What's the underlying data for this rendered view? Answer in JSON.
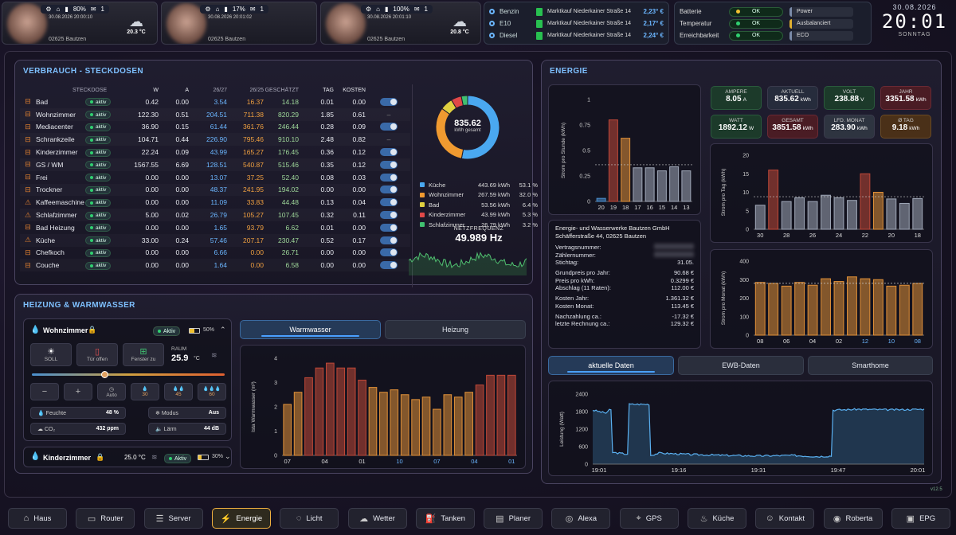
{
  "cams": [
    {
      "status": {
        "pct": "80%",
        "mail": "1"
      },
      "date": "30.08.2026 20:00:10",
      "zip": "02625 Bautzen",
      "temp": "20.3 °C"
    },
    {
      "status": {
        "pct": "17%",
        "mail": "1"
      },
      "date": "30.08.2026 20:01:02",
      "zip": "02625 Bautzen",
      "temp": ""
    },
    {
      "status": {
        "pct": "100%",
        "mail": "1"
      },
      "date": "30.08.2026 20:01:10",
      "zip": "02625 Bautzen",
      "temp": "20.8 °C"
    }
  ],
  "fuel": [
    {
      "name": "Benzin",
      "station": "Marktkauf Niederkainer Straße 14",
      "price": "2,23° €"
    },
    {
      "name": "E10",
      "station": "Marktkauf Niederkainer Straße 14",
      "price": "2,17° €"
    },
    {
      "name": "Diesel",
      "station": "Marktkauf Niederkainer Straße 14",
      "price": "2,24° €"
    }
  ],
  "system": [
    {
      "label": "Batterie",
      "status": "OK",
      "tag": "Power",
      "status_color": "#f0c030"
    },
    {
      "label": "Temperatur",
      "status": "OK",
      "tag": "Ausbalanciert",
      "status_color": "#30d070"
    },
    {
      "label": "Erreichbarkeit",
      "status": "OK",
      "tag": "ECO",
      "status_color": "#30d070"
    }
  ],
  "clock": {
    "date": "30.08.2026",
    "time": "20:01",
    "weekday": "SONNTAG"
  },
  "verbrauch": {
    "title": "VERBRAUCH - STECKDOSEN",
    "headers": [
      "STECKDOSE",
      "W",
      "A",
      "26/27",
      "26/25",
      "GESCHÄTZT",
      "TAG",
      "KOSTEN"
    ],
    "badge": "aktiv",
    "rows": [
      {
        "name": "Bad",
        "w": "0.42",
        "a": "0.00",
        "v1": "3.54",
        "v2": "16.37",
        "g": "14.18",
        "tag": "0.01",
        "k": "0.00",
        "sw": true,
        "icon": "plug"
      },
      {
        "name": "Wohnzimmer",
        "w": "122.30",
        "a": "0.51",
        "v1": "204.51",
        "v2": "711.38",
        "g": "820.29",
        "tag": "1.85",
        "k": "0.61",
        "sw": false,
        "icon": "plug"
      },
      {
        "name": "Mediacenter",
        "w": "36.90",
        "a": "0.15",
        "v1": "61.44",
        "v2": "361.76",
        "g": "246.44",
        "tag": "0.28",
        "k": "0.09",
        "sw": true,
        "icon": "plug"
      },
      {
        "name": "Schrankzeile",
        "w": "104.71",
        "a": "0.44",
        "v1": "226.90",
        "v2": "795.46",
        "g": "910.10",
        "tag": "2.48",
        "k": "0.82",
        "sw": false,
        "icon": "plug"
      },
      {
        "name": "Kinderzimmer",
        "w": "22.24",
        "a": "0.09",
        "v1": "43.99",
        "v2": "165.27",
        "g": "176.45",
        "tag": "0.36",
        "k": "0.12",
        "sw": true,
        "icon": "plug"
      },
      {
        "name": "GS / WM",
        "w": "1567.55",
        "a": "6.69",
        "v1": "128.51",
        "v2": "540.87",
        "g": "515.46",
        "tag": "0.35",
        "k": "0.12",
        "sw": true,
        "icon": "plug"
      },
      {
        "name": "Frei",
        "w": "0.00",
        "a": "0.00",
        "v1": "13.07",
        "v2": "37.25",
        "g": "52.40",
        "tag": "0.08",
        "k": "0.03",
        "sw": true,
        "icon": "plug"
      },
      {
        "name": "Trockner",
        "w": "0.00",
        "a": "0.00",
        "v1": "48.37",
        "v2": "241.95",
        "g": "194.02",
        "tag": "0.00",
        "k": "0.00",
        "sw": true,
        "icon": "plug"
      },
      {
        "name": "Kaffeemaschine",
        "w": "0.00",
        "a": "0.00",
        "v1": "11.09",
        "v2": "33.83",
        "g": "44.48",
        "tag": "0.13",
        "k": "0.04",
        "sw": true,
        "icon": "warn"
      },
      {
        "name": "Schlafzimmer",
        "w": "5.00",
        "a": "0.02",
        "v1": "26.79",
        "v2": "105.27",
        "g": "107.45",
        "tag": "0.32",
        "k": "0.11",
        "sw": true,
        "icon": "warn"
      },
      {
        "name": "Bad Heizung",
        "w": "0.00",
        "a": "0.00",
        "v1": "1.65",
        "v2": "93.79",
        "g": "6.62",
        "tag": "0.01",
        "k": "0.00",
        "sw": true,
        "icon": "plug"
      },
      {
        "name": "Küche",
        "w": "33.00",
        "a": "0.24",
        "v1": "57.46",
        "v2": "207.17",
        "g": "230.47",
        "tag": "0.52",
        "k": "0.17",
        "sw": true,
        "icon": "warn"
      },
      {
        "name": "Chefkoch",
        "w": "0.00",
        "a": "0.00",
        "v1": "6.66",
        "v2": "0.00",
        "g": "26.71",
        "tag": "0.00",
        "k": "0.00",
        "sw": true,
        "icon": "plug"
      },
      {
        "name": "Couche",
        "w": "0.00",
        "a": "0.00",
        "v1": "1.64",
        "v2": "0.00",
        "g": "6.58",
        "tag": "0.00",
        "k": "0.00",
        "sw": true,
        "icon": "plug"
      }
    ],
    "donut": {
      "value": "835.62",
      "unit": "kWh gesamt"
    },
    "legend": [
      {
        "name": "Küche",
        "kwh": "443.69 kWh",
        "pct": "53.1 %",
        "color": "#4aa8f0",
        "frac": 0.531
      },
      {
        "name": "Wohnzimmer",
        "kwh": "267.59 kWh",
        "pct": "32.0 %",
        "color": "#f09a30",
        "frac": 0.32
      },
      {
        "name": "Bad",
        "kwh": "53.56 kWh",
        "pct": "6.4 %",
        "color": "#e0d040",
        "frac": 0.064
      },
      {
        "name": "Kinderzimmer",
        "kwh": "43.99 kWh",
        "pct": "5.3 %",
        "color": "#e04848",
        "frac": 0.053
      },
      {
        "name": "Schlafzimmer",
        "kwh": "26.79 kWh",
        "pct": "3.2 %",
        "color": "#40c070",
        "frac": 0.032
      }
    ],
    "netz": {
      "label": "NETZFREQUENZ",
      "value": "49.989 Hz"
    }
  },
  "heizung": {
    "title": "HEIZUNG & WARMWASSER",
    "room1": {
      "name": "Wohnzimmer",
      "state": "Aktiv",
      "battery": "50%",
      "buttons": [
        "SOLL",
        "Tür offen",
        "Fenster zu"
      ],
      "raum_label": "RAUM",
      "raum_value": "25.9",
      "raum_unit": "°C",
      "modes": [
        "−",
        "+",
        "Auto",
        "30",
        "45",
        "60"
      ],
      "feuchte_label": "Feuchte",
      "feuchte": "48 %",
      "modus_label": "Modus",
      "modus": "Aus",
      "co2_label": "CO₂",
      "co2": "432 ppm",
      "laerm_label": "Lärm",
      "laerm": "44 dB",
      "slider": 0.36
    },
    "room2": {
      "name": "Kinderzimmer",
      "temp": "25.0 °C",
      "state": "Aktiv",
      "battery": "30%"
    },
    "tabs": [
      "Warmwasser",
      "Heizung"
    ]
  },
  "energie": {
    "title": "ENERGIE",
    "tiles": [
      {
        "label": "AMPERE",
        "value": "8.05",
        "unit": "A",
        "style": "t-g"
      },
      {
        "label": "AKTUELL",
        "value": "835.62",
        "unit": "kWh",
        "style": "t-b"
      },
      {
        "label": "VOLT",
        "value": "238.88",
        "unit": "V",
        "style": "t-g"
      },
      {
        "label": "JAHR",
        "value": "3351.58",
        "unit": "kWh",
        "style": "t-r"
      },
      {
        "label": "WATT",
        "value": "1892.12",
        "unit": "W",
        "style": "t-g"
      },
      {
        "label": "GESAMT",
        "value": "3851.58",
        "unit": "kWh",
        "style": "t-r"
      },
      {
        "label": "LFD. MONAT",
        "value": "283.90",
        "unit": "kWh",
        "style": "t-gr"
      },
      {
        "label": "Ø TAG",
        "value": "9.18",
        "unit": "kWh",
        "style": "t-o"
      }
    ],
    "info": {
      "company": "Energie- und Wasserwerke Bautzen GmbH",
      "address": "Schäfferstraße 44, 02625 Bautzen",
      "lines": [
        {
          "k": "Vertragsnummer:",
          "v": ""
        },
        {
          "k": "Zählernummer:",
          "v": ""
        },
        {
          "k": "Stichtag:",
          "v": "31.05."
        },
        {
          "k": "Grundpreis pro Jahr:",
          "v": "90.68 €"
        },
        {
          "k": "Preis pro kWh:",
          "v": "0.3299 €"
        },
        {
          "k": "Abschlag (11 Raten):",
          "v": "112.00 €"
        },
        {
          "k": "Kosten Jahr:",
          "v": "1.361.32 €"
        },
        {
          "k": "Kosten Monat:",
          "v": "113.45 €"
        },
        {
          "k": "Nachzahlung ca.:",
          "v": "-17.32 €"
        },
        {
          "k": "letzte Rechnung ca.:",
          "v": "129.32 €"
        }
      ]
    },
    "tabs": [
      "aktuelle Daten",
      "EWB-Daten",
      "Smarthome"
    ]
  },
  "chart_data": [
    {
      "id": "strom-stunde",
      "type": "bar",
      "ylabel": "Strom pro Stunde (kWh)",
      "ylim": [
        0,
        1
      ],
      "yticks": [
        0,
        0.25,
        0.5,
        0.75,
        1
      ],
      "categories": [
        "20",
        "19",
        "18",
        "17",
        "16",
        "15",
        "14",
        "13"
      ],
      "values": [
        0.03,
        0.8,
        0.62,
        0.33,
        0.33,
        0.3,
        0.34,
        0.3
      ],
      "colors": [
        "#4a90d0",
        "#c04838",
        "#e09038",
        "#a0a8b8",
        "#a0a8b8",
        "#a0a8b8",
        "#a0a8b8",
        "#a0a8b8"
      ],
      "avg": 0.36
    },
    {
      "id": "strom-tag",
      "type": "bar",
      "ylabel": "Strom pro Tag (kWh)",
      "ylim": [
        0,
        20
      ],
      "yticks": [
        0,
        5,
        10,
        15,
        20
      ],
      "categories": [
        "30",
        "28",
        "26",
        "24",
        "22",
        "20",
        "18"
      ],
      "values": [
        6.5,
        16,
        7.5,
        8.5,
        7.5,
        9.2,
        8.5,
        7.8,
        15,
        10,
        8.2,
        7,
        8.3
      ],
      "colors": [
        "#a0a8b8",
        "#c04838",
        "#a0a8b8",
        "#a0a8b8",
        "#a0a8b8",
        "#a0a8b8",
        "#a0a8b8",
        "#a0a8b8",
        "#c04838",
        "#e09038",
        "#a0a8b8",
        "#a0a8b8",
        "#a0a8b8"
      ],
      "avg": 8.8
    },
    {
      "id": "strom-monat",
      "type": "bar",
      "ylabel": "Strom pro Monat (kWh)",
      "ylim": [
        0,
        400
      ],
      "yticks": [
        0,
        100,
        200,
        300,
        400
      ],
      "categories": [
        "08",
        "06",
        "04",
        "02",
        "12",
        "10",
        "08"
      ],
      "values": [
        285,
        280,
        265,
        285,
        270,
        305,
        290,
        315,
        305,
        300,
        265,
        270,
        280
      ],
      "colors": [
        "#e09038",
        "#e09038",
        "#e09038",
        "#e09038",
        "#e09038",
        "#e09038",
        "#e09038",
        "#e09038",
        "#e09038",
        "#e09038",
        "#e09038",
        "#e09038",
        "#e09038"
      ],
      "avg": 280
    },
    {
      "id": "warmwasser",
      "type": "bar",
      "ylabel": "Ista Warmwasser (m³)",
      "ylim": [
        0,
        4
      ],
      "yticks": [
        0,
        1,
        2,
        3,
        4
      ],
      "categories": [
        "07",
        "04",
        "01",
        "10",
        "07",
        "04",
        "01"
      ],
      "values": [
        2.1,
        2.6,
        3.2,
        3.6,
        3.8,
        3.6,
        3.6,
        3.1,
        2.8,
        2.6,
        2.7,
        2.5,
        2.3,
        2.4,
        1.9,
        2.5,
        2.4,
        2.6,
        2.9,
        3.3,
        3.3,
        3.3
      ],
      "colors": [
        "#e09038",
        "#e09038",
        "#c04838",
        "#c04838",
        "#c04838",
        "#c04838",
        "#c04838",
        "#c04838",
        "#e09038",
        "#e09038",
        "#e09038",
        "#e09038",
        "#e09038",
        "#e09038",
        "#e09038",
        "#e09038",
        "#e09038",
        "#e09038",
        "#c04838",
        "#c04838",
        "#c04838",
        "#c04838"
      ]
    },
    {
      "id": "leistung",
      "type": "area",
      "ylabel": "Leistung (Watt)",
      "ylim": [
        0,
        2400
      ],
      "yticks": [
        0,
        600,
        1200,
        1800,
        2400
      ],
      "xticks": [
        "19:01",
        "19:16",
        "19:31",
        "19:47",
        "20:01"
      ]
    }
  ],
  "version": "v12.5",
  "nav": [
    {
      "label": "Haus",
      "icon": "⌂"
    },
    {
      "label": "Router",
      "icon": "▭"
    },
    {
      "label": "Server",
      "icon": "☰"
    },
    {
      "label": "Energie",
      "icon": "⚡"
    },
    {
      "label": "Licht",
      "icon": "◌"
    },
    {
      "label": "Wetter",
      "icon": "☁"
    },
    {
      "label": "Tanken",
      "icon": "⛽"
    },
    {
      "label": "Planer",
      "icon": "▤"
    },
    {
      "label": "Alexa",
      "icon": "◎"
    },
    {
      "label": "GPS",
      "icon": "⌖"
    },
    {
      "label": "Küche",
      "icon": "♨"
    },
    {
      "label": "Kontakt",
      "icon": "☺"
    },
    {
      "label": "Roberta",
      "icon": "◉"
    },
    {
      "label": "EPG",
      "icon": "▣"
    }
  ]
}
